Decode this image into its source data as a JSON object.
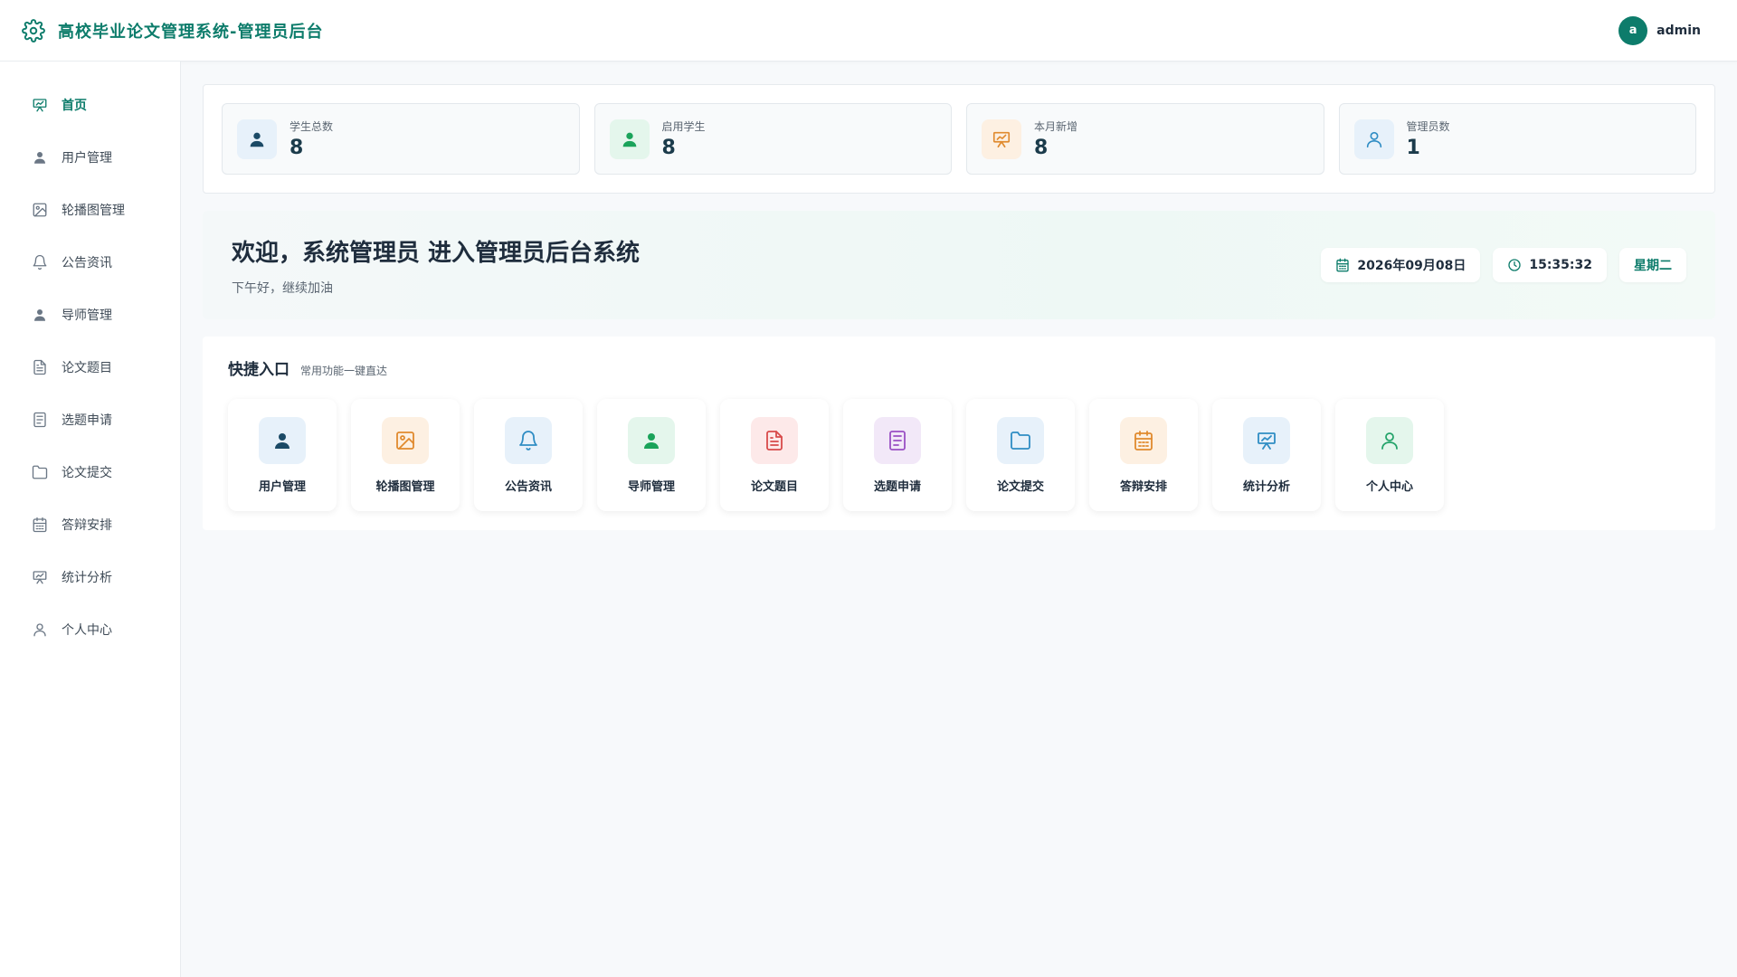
{
  "header": {
    "logo_icon": "gear-icon",
    "title": "高校毕业论文管理系统-管理员后台",
    "avatar_letter": "a",
    "username": "admin"
  },
  "sidebar": {
    "items": [
      {
        "label": "首页",
        "icon": "presentation-icon",
        "active": true
      },
      {
        "label": "用户管理",
        "icon": "user-icon"
      },
      {
        "label": "轮播图管理",
        "icon": "image-icon"
      },
      {
        "label": "公告资讯",
        "icon": "bell-icon"
      },
      {
        "label": "导师管理",
        "icon": "user-icon"
      },
      {
        "label": "论文题目",
        "icon": "document-icon"
      },
      {
        "label": "选题申请",
        "icon": "list-document-icon"
      },
      {
        "label": "论文提交",
        "icon": "folder-icon"
      },
      {
        "label": "答辩安排",
        "icon": "calendar-icon"
      },
      {
        "label": "统计分析",
        "icon": "presentation-icon"
      },
      {
        "label": "个人中心",
        "icon": "user-outline-icon"
      }
    ]
  },
  "stats": [
    {
      "label": "学生总数",
      "value": "8",
      "icon": "user-icon",
      "color": "#1b4a66"
    },
    {
      "label": "启用学生",
      "value": "8",
      "icon": "user-icon",
      "color": "#1aa35a"
    },
    {
      "label": "本月新增",
      "value": "8",
      "icon": "presentation-icon",
      "color": "#e08a2e"
    },
    {
      "label": "管理员数",
      "value": "1",
      "icon": "user-outline-icon",
      "color": "#2f8dc4"
    }
  ],
  "welcome": {
    "title": "欢迎，系统管理员 进入管理员后台系统",
    "subtitle": "下午好，继续加油",
    "date": "2026年09月08日",
    "time": "15:35:32",
    "weekday": "星期二"
  },
  "quick": {
    "title": "快捷入口",
    "subtitle": "常用功能一键直达",
    "items": [
      {
        "label": "用户管理",
        "icon": "user-icon",
        "color": "#1b4a66"
      },
      {
        "label": "轮播图管理",
        "icon": "image-icon",
        "color": "#e08a2e"
      },
      {
        "label": "公告资讯",
        "icon": "bell-icon",
        "color": "#2f8dc4"
      },
      {
        "label": "导师管理",
        "icon": "user-icon",
        "color": "#1aa35a"
      },
      {
        "label": "论文题目",
        "icon": "document-icon",
        "color": "#d84a4a"
      },
      {
        "label": "选题申请",
        "icon": "list-document-icon",
        "color": "#9a4fc4"
      },
      {
        "label": "论文提交",
        "icon": "folder-icon",
        "color": "#2f8dc4"
      },
      {
        "label": "答辩安排",
        "icon": "calendar-icon",
        "color": "#e08a2e"
      },
      {
        "label": "统计分析",
        "icon": "presentation-icon",
        "color": "#2f8dc4"
      },
      {
        "label": "个人中心",
        "icon": "user-outline-icon",
        "color": "#24a36a"
      }
    ]
  }
}
